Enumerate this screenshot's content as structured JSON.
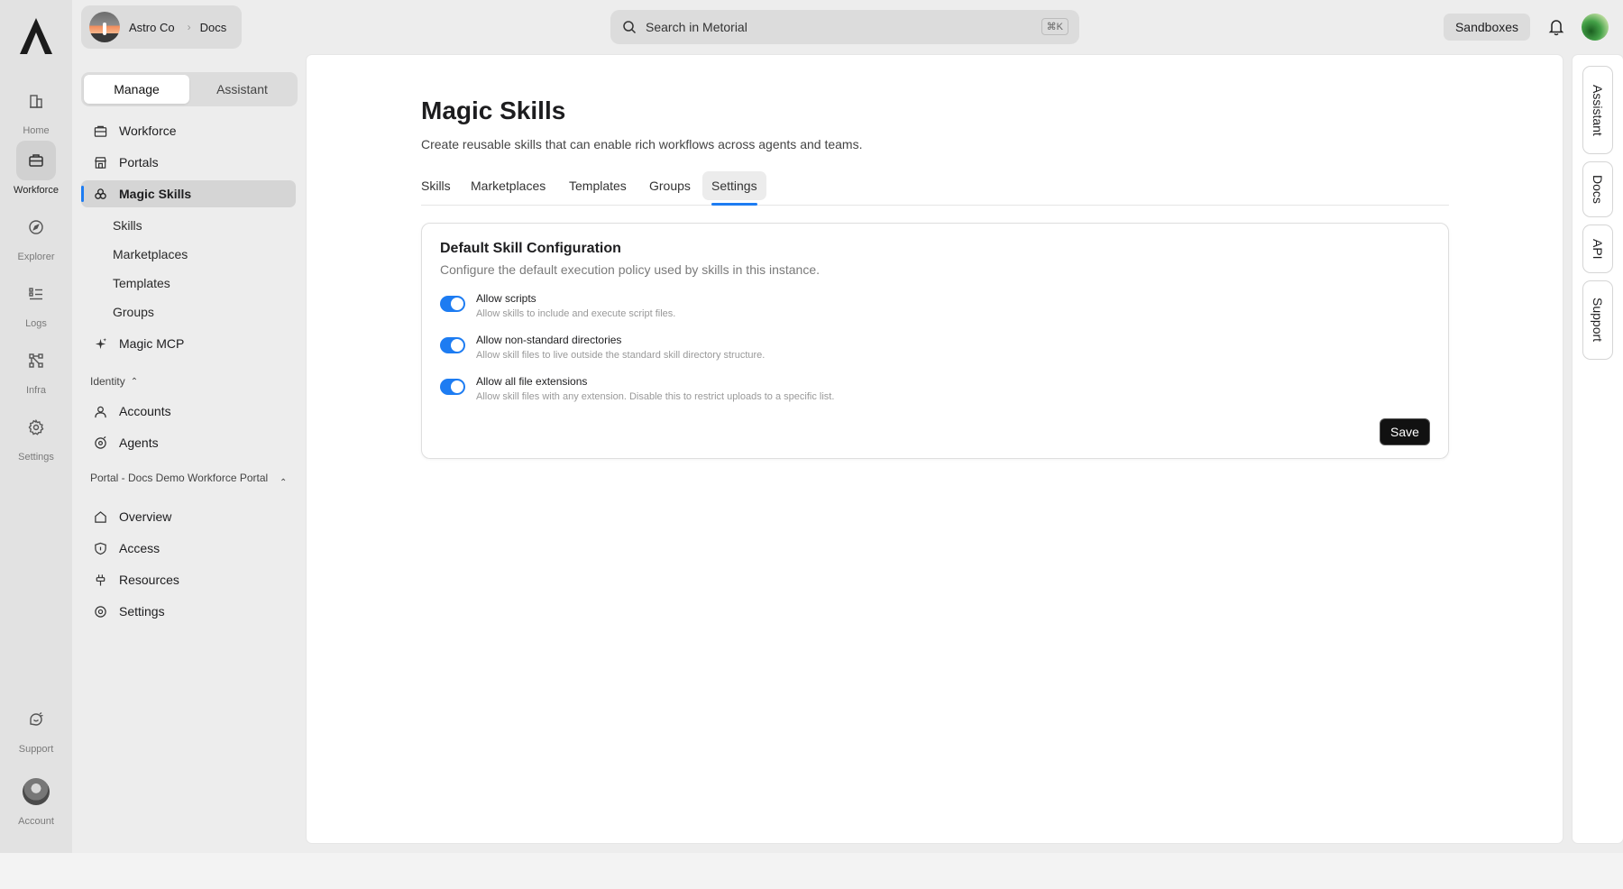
{
  "rail": {
    "items": [
      {
        "label": "Home",
        "icon": "home-icon"
      },
      {
        "label": "Workforce",
        "icon": "briefcase-icon"
      },
      {
        "label": "Explorer",
        "icon": "compass-icon"
      },
      {
        "label": "Logs",
        "icon": "list-icon"
      },
      {
        "label": "Infra",
        "icon": "nodes-icon"
      },
      {
        "label": "Settings",
        "icon": "gear-icon"
      }
    ],
    "support_label": "Support",
    "account_label": "Account"
  },
  "org": {
    "name": "Astro Co",
    "crumb": "Docs"
  },
  "switcher": {
    "manage": "Manage",
    "assistant": "Assistant"
  },
  "sidebar": {
    "items": [
      {
        "label": "Workforce"
      },
      {
        "label": "Portals"
      },
      {
        "label": "Magic Skills"
      },
      {
        "label": "Magic MCP"
      }
    ],
    "sub_items": [
      "Skills",
      "Marketplaces",
      "Templates",
      "Groups"
    ],
    "identity_label": "Identity",
    "identity_items": [
      "Accounts",
      "Agents"
    ],
    "portal_label": "Portal - Docs Demo Workforce Portal",
    "portal_items": [
      "Overview",
      "Access",
      "Resources",
      "Settings"
    ]
  },
  "topbar": {
    "search_placeholder": "Search in Metorial",
    "shortcut": "⌘K",
    "sandboxes": "Sandboxes"
  },
  "page": {
    "title": "Magic Skills",
    "subtitle": "Create reusable skills that can enable rich workflows across agents and teams.",
    "tabs": [
      "Skills",
      "Marketplaces",
      "Templates",
      "Groups",
      "Settings"
    ],
    "active_tab": "Settings"
  },
  "card": {
    "title": "Default Skill Configuration",
    "subtitle": "Configure the default execution policy used by skills in this instance.",
    "options": [
      {
        "title": "Allow scripts",
        "desc": "Allow skills to include and execute script files.",
        "enabled": true
      },
      {
        "title": "Allow non-standard directories",
        "desc": "Allow skill files to live outside the standard skill directory structure.",
        "enabled": true
      },
      {
        "title": "Allow all file extensions",
        "desc": "Allow skill files with any extension. Disable this to restrict uploads to a specific list.",
        "enabled": true
      }
    ],
    "save_label": "Save"
  },
  "right_rail": {
    "tabs": [
      "Assistant",
      "Docs",
      "API",
      "Support"
    ]
  },
  "colors": {
    "accent": "#1d7cf2",
    "save_bg": "#111111"
  }
}
